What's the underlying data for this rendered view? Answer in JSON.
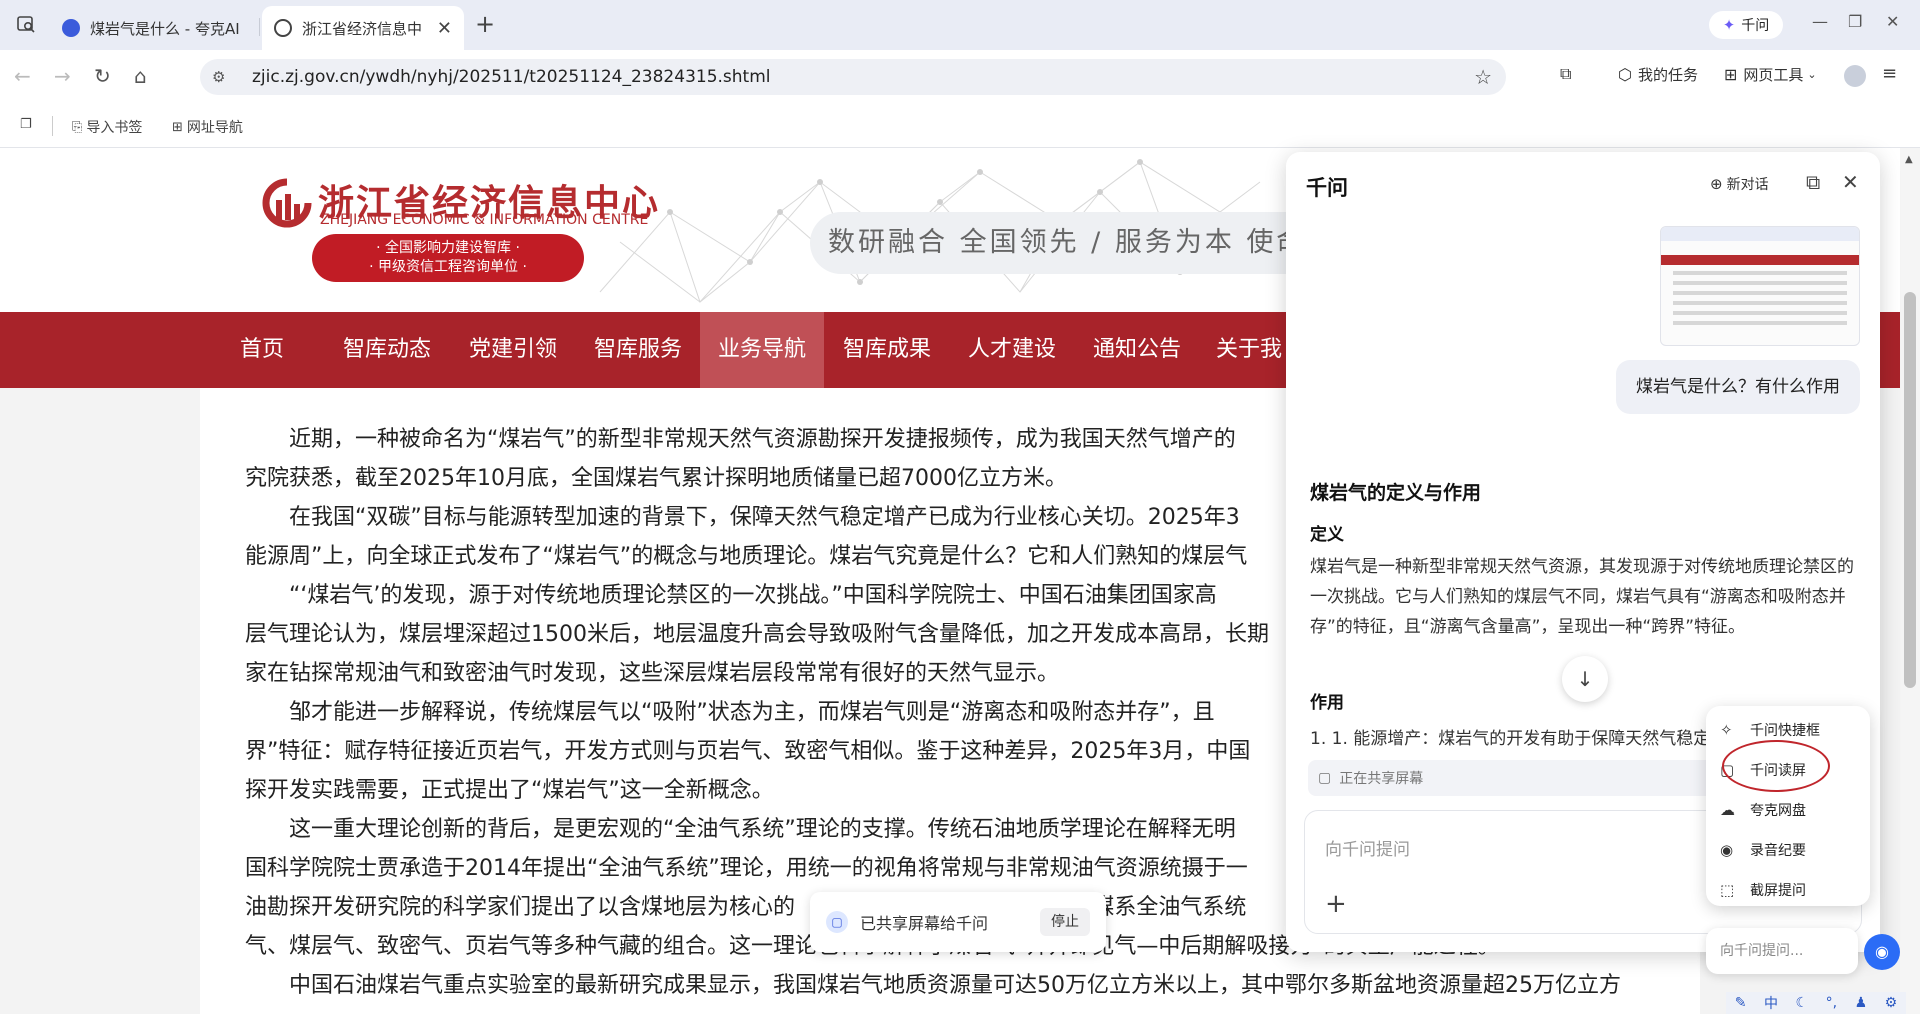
{
  "browser": {
    "tabs": [
      {
        "title": "煤岩气是什么 - 夸克AI"
      },
      {
        "title": "浙江省经济信息中"
      }
    ],
    "qianwen_pill": "千问",
    "url": "zjic.zj.gov.cn/ywdh/nyhj/202511/t20251124_23824315.shtml",
    "tools": {
      "tasks": "我的任务",
      "webtools": "网页工具"
    },
    "bookmarks": [
      {
        "label": "导入书签"
      },
      {
        "label": "网址导航"
      }
    ]
  },
  "site": {
    "logo_cn": "浙江省经济信息中心",
    "logo_en": "ZHEJIANG ECONOMIC & INFORMATION CENTRE",
    "badge_line1": "· 全国影响力建设智库 ·",
    "badge_line2": "· 甲级资信工程咨询单位 ·",
    "slogan": "数研融合 全国领先 / 服务为本 使命",
    "nav": [
      "首页",
      "智库动态",
      "党建引领",
      "智库服务",
      "业务导航",
      "智库成果",
      "人才建设",
      "通知公告",
      "关于我"
    ]
  },
  "article": {
    "paragraphs": [
      "　　近期，一种被命名为“煤岩气”的新型非常规天然气资源勘探开发捷报频传，成为我国天然气增产的",
      "究院获悉，截至2025年10月底，全国煤岩气累计探明地质储量已超7000亿立方米。",
      "　　在我国“双碳”目标与能源转型加速的背景下，保障天然气稳定增产已成为行业核心关切。2025年3",
      "能源周”上，向全球正式发布了“煤岩气”的概念与地质理论。煤岩气究竟是什么？它和人们熟知的煤层气",
      "　　“‘煤岩气’的发现，源于对传统地质理论禁区的一次挑战。”中国科学院院士、中国石油集团国家高",
      "层气理论认为，煤层埋深超过1500米后，地层温度升高会导致吸附气含量降低，加之开发成本高昂，长期",
      "家在钻探常规油气和致密油气时发现，这些深层煤岩层段常常有很好的天然气显示。",
      "　　邹才能进一步解释说，传统煤层气以“吸附”状态为主，而煤岩气则是“游离态和吸附态并存”，且",
      "界”特征：赋存特征接近页岩气，开发方式则与页岩气、致密气相似。鉴于这种差异，2025年3月，中国",
      "探开发实践需要，正式提出了“煤岩气”这一全新概念。",
      "　　这一重大理论创新的背后，是更宏观的“全油气系统”理论的支撑。传统石油地质学理论在解释无明",
      "国科学院院士贾承造于2014年提出“全油气系统”理论，用统一的视角将常规与非常规油气资源统摄于一",
      "油勘探开发研究院的科学家们提出了以含煤地层为核心的　　　　　　　　　　　　　“煤系全油气系统",
      "气、煤层气、致密气、页岩气等多种气藏的组合。这一理论也科学解释了煤岩气“井井即见气—中后期解吸接力”的典型产能过程。",
      "　　中国石油煤岩气重点实验室的最新研究成果显示，我国煤岩气地质资源量可达50万亿立方米以上，其中鄂尔多斯盆地资源量超25万亿立方"
    ]
  },
  "share_bar": {
    "text": "已共享屏幕给千问",
    "stop": "停止"
  },
  "qianwen_panel": {
    "title": "千问",
    "new_chat": "新对话",
    "user_message": "煤岩气是什么？有什么作用",
    "answer_title": "煤岩气的定义与作用",
    "section_def": "定义",
    "def_text": "煤岩气是一种新型非常规天然气资源，其发现源于对传统地质理论禁区的一次挑战。它与人们熟知的煤层气不同，煤岩气具有“游离态和吸附态并存”的特征，且“游离气含量高”，呈现出一种“跨界”特征。",
    "section_use": "作用",
    "use_item1": "1. 1. 能源增产：煤岩气的开发有助于保障天然气稳定",
    "sharing_status": "正在共享屏幕",
    "input_placeholder": "向千问提问"
  },
  "float_menu": {
    "items": [
      {
        "label": "千问快捷框",
        "icon": "quick-box-icon"
      },
      {
        "label": "千问读屏",
        "icon": "read-screen-icon"
      },
      {
        "label": "夸克网盘",
        "icon": "cloud-drive-icon"
      },
      {
        "label": "录音纪要",
        "icon": "recording-icon"
      },
      {
        "label": "截屏提问",
        "icon": "screenshot-icon"
      }
    ],
    "mini_ask_placeholder": "向千问提问..."
  },
  "ime": {
    "lang": "中"
  }
}
